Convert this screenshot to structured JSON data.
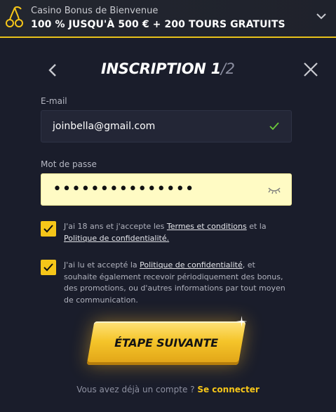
{
  "banner": {
    "subtitle": "Casino Bonus de Bienvenue",
    "title": "100 % JUSQU'À 500 € + 200 TOURS GRATUITS",
    "icons": {
      "logo": "cherries-icon",
      "expand": "chevron-down-icon"
    }
  },
  "header": {
    "title": "INSCRIPTION 1",
    "step_total": "/2",
    "icons": {
      "back": "chevron-left-icon",
      "close": "close-icon"
    }
  },
  "form": {
    "email": {
      "label": "E-mail",
      "value": "joinbella@gmail.com",
      "valid_icon": "check-icon"
    },
    "password": {
      "label": "Mot de passe",
      "value": "•••••••••••••••",
      "reveal_icon": "eye-closed-icon"
    },
    "checkbox1": {
      "checked": true,
      "text_1": "J'ai 18 ans et j'accepte les ",
      "link_1": "Termes et conditions",
      "text_2": " et la ",
      "link_2": "Politique de confidentialité."
    },
    "checkbox2": {
      "checked": true,
      "text_1": "J'ai lu et accepté la ",
      "link_1": "Politique de confidentialité",
      "text_2": ", et souhaite également recevoir périodiquement des bonus, des promotions, ou d'autres informations par tout moyen de communication."
    }
  },
  "cta": {
    "label": "ÉTAPE SUIVANTE"
  },
  "footer": {
    "text": "Vous avez déjà un compte ? ",
    "link": "Se connecter"
  },
  "colors": {
    "accent": "#f6c619",
    "background": "#1a1d2b",
    "field": "#232636",
    "password_field": "#fffbc4"
  }
}
